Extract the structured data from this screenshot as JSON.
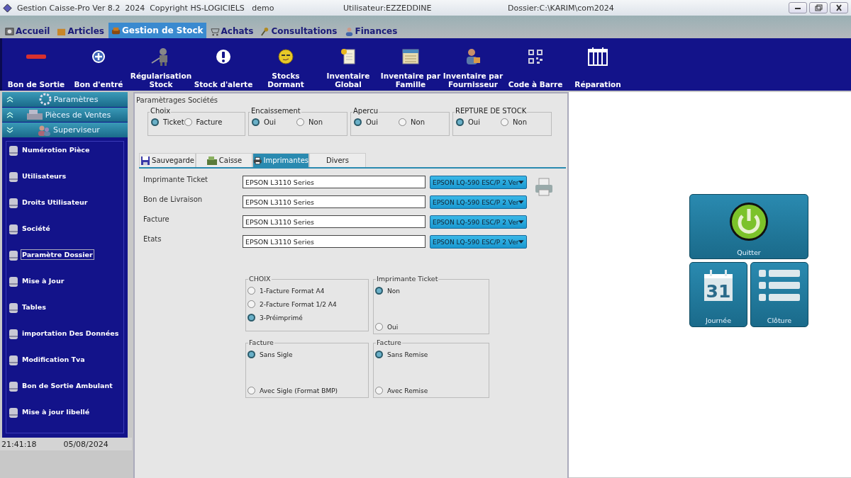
{
  "title_bar": {
    "title": "Gestion Caisse-Pro Ver 8.2  2024  Copyright HS-LOGICIELS   demo",
    "user": "Utilisateur:EZZEDDINE",
    "folder": "Dossier:C:\\KARIM\\com2024"
  },
  "menu_tabs": [
    {
      "label": "Accueil",
      "kind": "home",
      "selected": false
    },
    {
      "label": "Articles",
      "kind": "box",
      "selected": false
    },
    {
      "label": "Gestion de Stock",
      "kind": "sofa",
      "selected": true
    },
    {
      "label": "Achats",
      "kind": "cart",
      "selected": false
    },
    {
      "label": "Consultations",
      "kind": "key",
      "selected": false
    },
    {
      "label": "Finances",
      "kind": "person",
      "selected": false
    }
  ],
  "toolbar": [
    {
      "label": "Bon de Sortie",
      "kind": "minus"
    },
    {
      "label": "Bon d'entré",
      "kind": "plus"
    },
    {
      "label": "Régularisation\nStock",
      "kind": "robot"
    },
    {
      "label": "Stock d'alerte",
      "kind": "alert"
    },
    {
      "label": "Stocks\nDormant",
      "kind": "smiley"
    },
    {
      "label": "Inventaire\nGlobal",
      "kind": "doc"
    },
    {
      "label": "Inventaire par\nFamille",
      "kind": "window"
    },
    {
      "label": "Inventaire par\nFournisseur",
      "kind": "person"
    },
    {
      "label": "Code à Barre",
      "kind": "qr"
    },
    {
      "label": "Réparation",
      "kind": "calendar"
    }
  ],
  "sidebar": {
    "sections": [
      {
        "label": "Paramètres",
        "kind": "gear",
        "expanded": false
      },
      {
        "label": "Pièces de Ventes",
        "kind": "register",
        "expanded": false
      },
      {
        "label": "Superviseur",
        "kind": "users",
        "expanded": true
      }
    ],
    "items": [
      {
        "label": "Numérotion Pièce",
        "focused": false
      },
      {
        "label": "Utilisateurs",
        "focused": false
      },
      {
        "label": "Droits Utilisateur",
        "focused": false
      },
      {
        "label": "Société",
        "focused": false
      },
      {
        "label": "Paramètre Dossier",
        "focused": true
      },
      {
        "label": "Mise à Jour",
        "focused": false
      },
      {
        "label": "Tables",
        "focused": false
      },
      {
        "label": "importation Des Données",
        "focused": false
      },
      {
        "label": "Modification Tva",
        "focused": false
      },
      {
        "label": "Bon de Sortie Ambulant",
        "focused": false
      },
      {
        "label": "Mise à jour libellé",
        "focused": false
      }
    ]
  },
  "status_bar": {
    "time": "21:41:18",
    "date": "05/08/2024"
  },
  "panel": {
    "title": "Paramètrages Sociétés",
    "option_groups": [
      {
        "legend": "Choix",
        "options": [
          {
            "label": "Ticket",
            "selected": true
          },
          {
            "label": "Facture",
            "selected": false
          }
        ]
      },
      {
        "legend": "Encaissement",
        "options": [
          {
            "label": "Oui",
            "selected": true
          },
          {
            "label": "Non",
            "selected": false
          }
        ]
      },
      {
        "legend": "Apercu",
        "options": [
          {
            "label": "Oui",
            "selected": true
          },
          {
            "label": "Non",
            "selected": false
          }
        ]
      },
      {
        "legend": "REPTURE DE STOCK",
        "options": [
          {
            "label": "Oui",
            "selected": true
          },
          {
            "label": "Non",
            "selected": false
          }
        ]
      }
    ],
    "tabs": [
      {
        "label": "Sauvegarde",
        "kind": "floppy",
        "selected": false
      },
      {
        "label": "Caisse",
        "kind": "register",
        "selected": false
      },
      {
        "label": "Imprimantes",
        "kind": "printer",
        "selected": true
      },
      {
        "label": "Divers",
        "selected": false
      }
    ],
    "printers": [
      {
        "label": "Imprimante Ticket",
        "value": "EPSON L3110 Series",
        "driver": "EPSON LQ-590 ESC/P 2 Ver"
      },
      {
        "label": "Bon de Livraison",
        "value": "EPSON L3110 Series",
        "driver": "EPSON LQ-590 ESC/P 2 Ver"
      },
      {
        "label": "Facture",
        "value": "EPSON L3110 Series",
        "driver": "EPSON LQ-590 ESC/P 2 Ver"
      },
      {
        "label": "Etats",
        "value": "EPSON L3110 Series",
        "driver": "EPSON LQ-590 ESC/P 2 Ver"
      }
    ],
    "format_groups": [
      {
        "legend": "CHOIX",
        "options": [
          {
            "label": "1-Facture Format A4",
            "selected": false
          },
          {
            "label": "2-Facture Format 1/2 A4",
            "selected": false
          },
          {
            "label": "3-Préimprimé",
            "selected": true
          }
        ]
      },
      {
        "legend": "Imprimante Ticket",
        "options": [
          {
            "label": "Non",
            "selected": true
          },
          {
            "label": "Oui",
            "selected": false
          }
        ]
      },
      {
        "legend": "Facture",
        "options": [
          {
            "label": "Sans Sigle",
            "selected": true
          },
          {
            "label": "Avec Sigle (Format BMP)",
            "selected": false
          }
        ]
      },
      {
        "legend": "Facture",
        "options": [
          {
            "label": "Sans Remise",
            "selected": true
          },
          {
            "label": "Avec Remise",
            "selected": false
          }
        ]
      }
    ]
  },
  "tiles": [
    {
      "label": "Quitter",
      "kind": "power"
    },
    {
      "label": "Journée",
      "kind": "calendar",
      "day": "31"
    },
    {
      "label": "Clôture",
      "kind": "list"
    }
  ]
}
